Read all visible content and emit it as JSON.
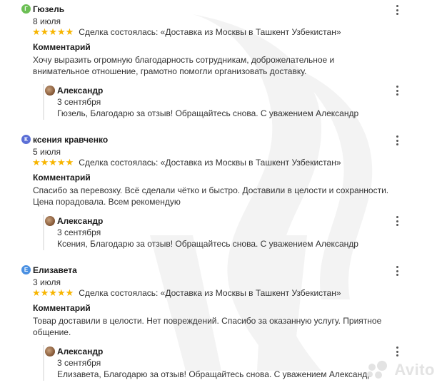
{
  "reviews": [
    {
      "avatar_letter": "Г",
      "avatar_color": "#6cbf55",
      "author": "Гюзель",
      "date": "8 июля",
      "stars": "★★★★★",
      "deal": "Сделка состоялась: «Доставка из Москвы в Ташкент Узбекистан»",
      "comment_title": "Комментарий",
      "comment_text": "Хочу выразить огромную благодарность сотрудникам, доброжелательное и внимательное отношение, грамотно помогли организовать доставку.",
      "reply": {
        "author": "Александр",
        "date": "3 сентября",
        "text": "Гюзель, Благодарю за отзыв! Обращайтесь снова. С уважением Александр"
      }
    },
    {
      "avatar_letter": "К",
      "avatar_color": "#5b6fd6",
      "author": "ксения кравченко",
      "date": "5 июля",
      "stars": "★★★★★",
      "deal": "Сделка состоялась: «Доставка из Москвы в Ташкент Узбекистан»",
      "comment_title": "Комментарий",
      "comment_text": "Спасибо за перевозку. Всё сделали чётко и быстро. Доставили в целости и сохранности. Цена порадовала. Всем рекомендую",
      "reply": {
        "author": "Александр",
        "date": "3 сентября",
        "text": "Ксения, Благодарю за отзыв! Обращайтесь снова. С уважением Александр"
      }
    },
    {
      "avatar_letter": "Е",
      "avatar_color": "#4a90e2",
      "author": "Елизавета",
      "date": "3 июля",
      "stars": "★★★★★",
      "deal": "Сделка состоялась: «Доставка из Москвы в Ташкент Узбекистан»",
      "comment_title": "Комментарий",
      "comment_text": "Товар доставили в целости. Нет повреждений. Спасибо за оказанную услугу. Приятное общение.",
      "reply": {
        "author": "Александр",
        "date": "3 сентября",
        "text": "Елизавета, Благодарю за отзыв! Обращайтесь снова. С уважением Александр"
      }
    }
  ],
  "icons": {
    "menu": "more-vertical-icon",
    "star": "star-icon"
  },
  "watermark": {
    "brand": "Avito"
  }
}
